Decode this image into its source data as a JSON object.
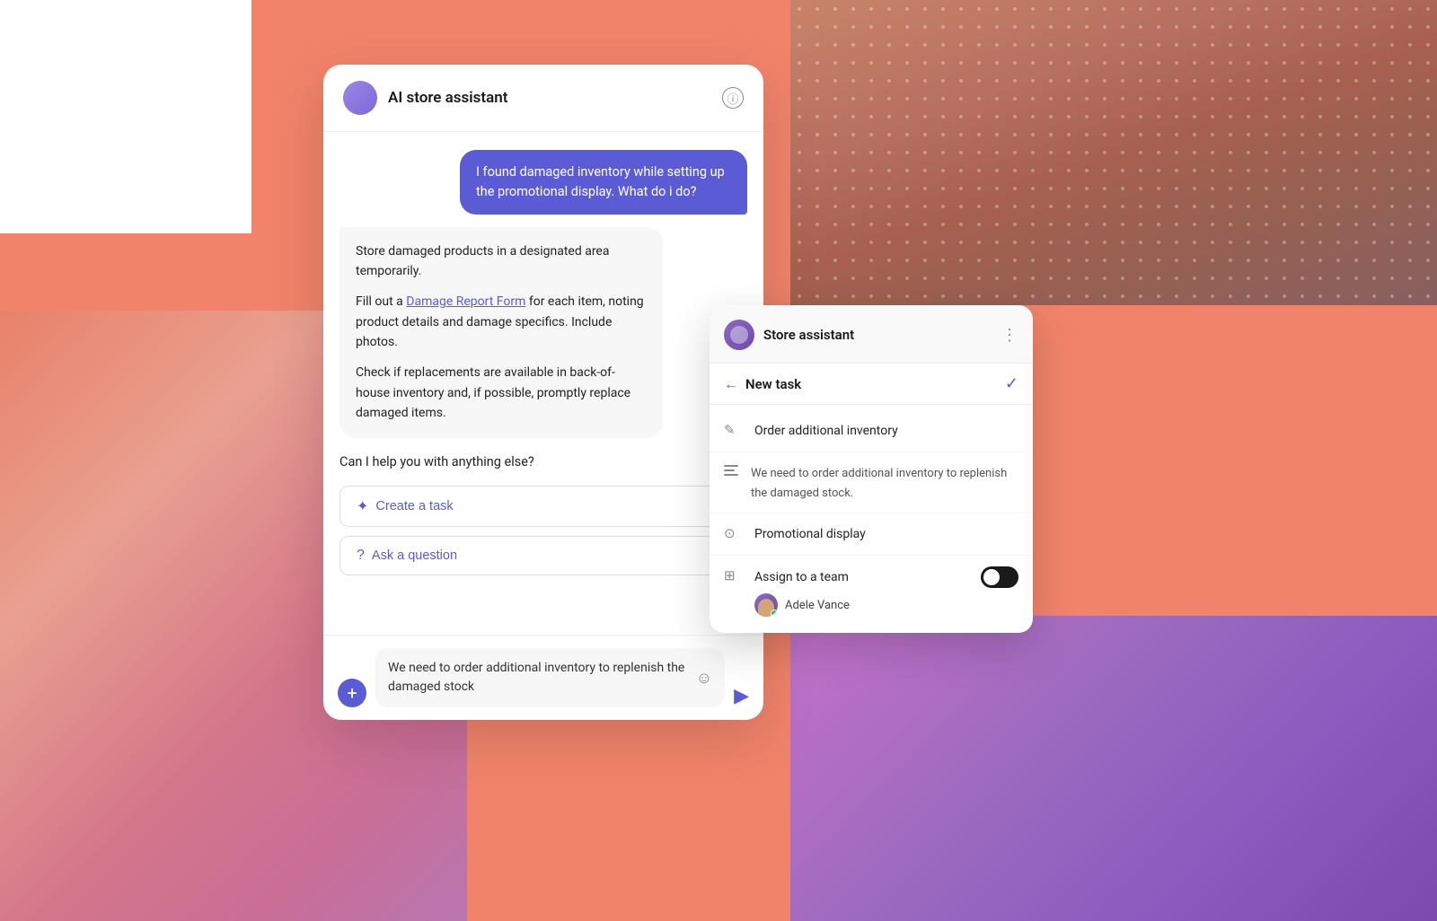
{
  "background": {
    "top_right_desc": "fabric texture gradient",
    "left_gradient_desc": "peach to rose gradient"
  },
  "chat_panel": {
    "header": {
      "title": "AI store assistant",
      "info_icon": "ⓘ"
    },
    "messages": [
      {
        "type": "user",
        "text": "I found damaged inventory while setting up the promotional display. What do i do?"
      },
      {
        "type": "ai",
        "paragraphs": [
          "Store damaged products in a designated area temporarily.",
          "Fill out a [Damage Report Form] for each item, noting product details and damage specifics. Include photos.",
          "Check if replacements are available in back-of-house inventory and, if possible, promptly replace damaged items."
        ],
        "link_text": "Damage Report Form"
      }
    ],
    "question": "Can I help you with anything else?",
    "action_buttons": [
      {
        "icon": "✦",
        "label": "Create a task"
      },
      {
        "icon": "?",
        "label": "Ask a question"
      }
    ],
    "input": {
      "text": "We need to order additional inventory to replenish the damaged stock",
      "emoji_icon": "☺",
      "send_icon": "▶"
    },
    "plus_btn": "+"
  },
  "task_panel": {
    "header": {
      "avatar_desc": "store assistant avatar",
      "title": "Store assistant",
      "menu_icon": "⋮"
    },
    "nav": {
      "back_icon": "←",
      "title": "New task",
      "check_icon": "✓"
    },
    "fields": [
      {
        "icon_type": "pencil",
        "icon_char": "✎",
        "value": "Order additional inventory",
        "type": "title"
      },
      {
        "icon_type": "lines",
        "value": "We need to order additional inventory to replenish the damaged stock.",
        "type": "description"
      },
      {
        "icon_type": "location",
        "icon_char": "⊙",
        "value": "Promotional display",
        "type": "location"
      },
      {
        "icon_type": "assign",
        "icon_char": "⊞",
        "label": "Assign to a team",
        "toggle": true,
        "assignee": {
          "name": "Adele Vance",
          "online": true
        },
        "type": "assign"
      }
    ]
  }
}
